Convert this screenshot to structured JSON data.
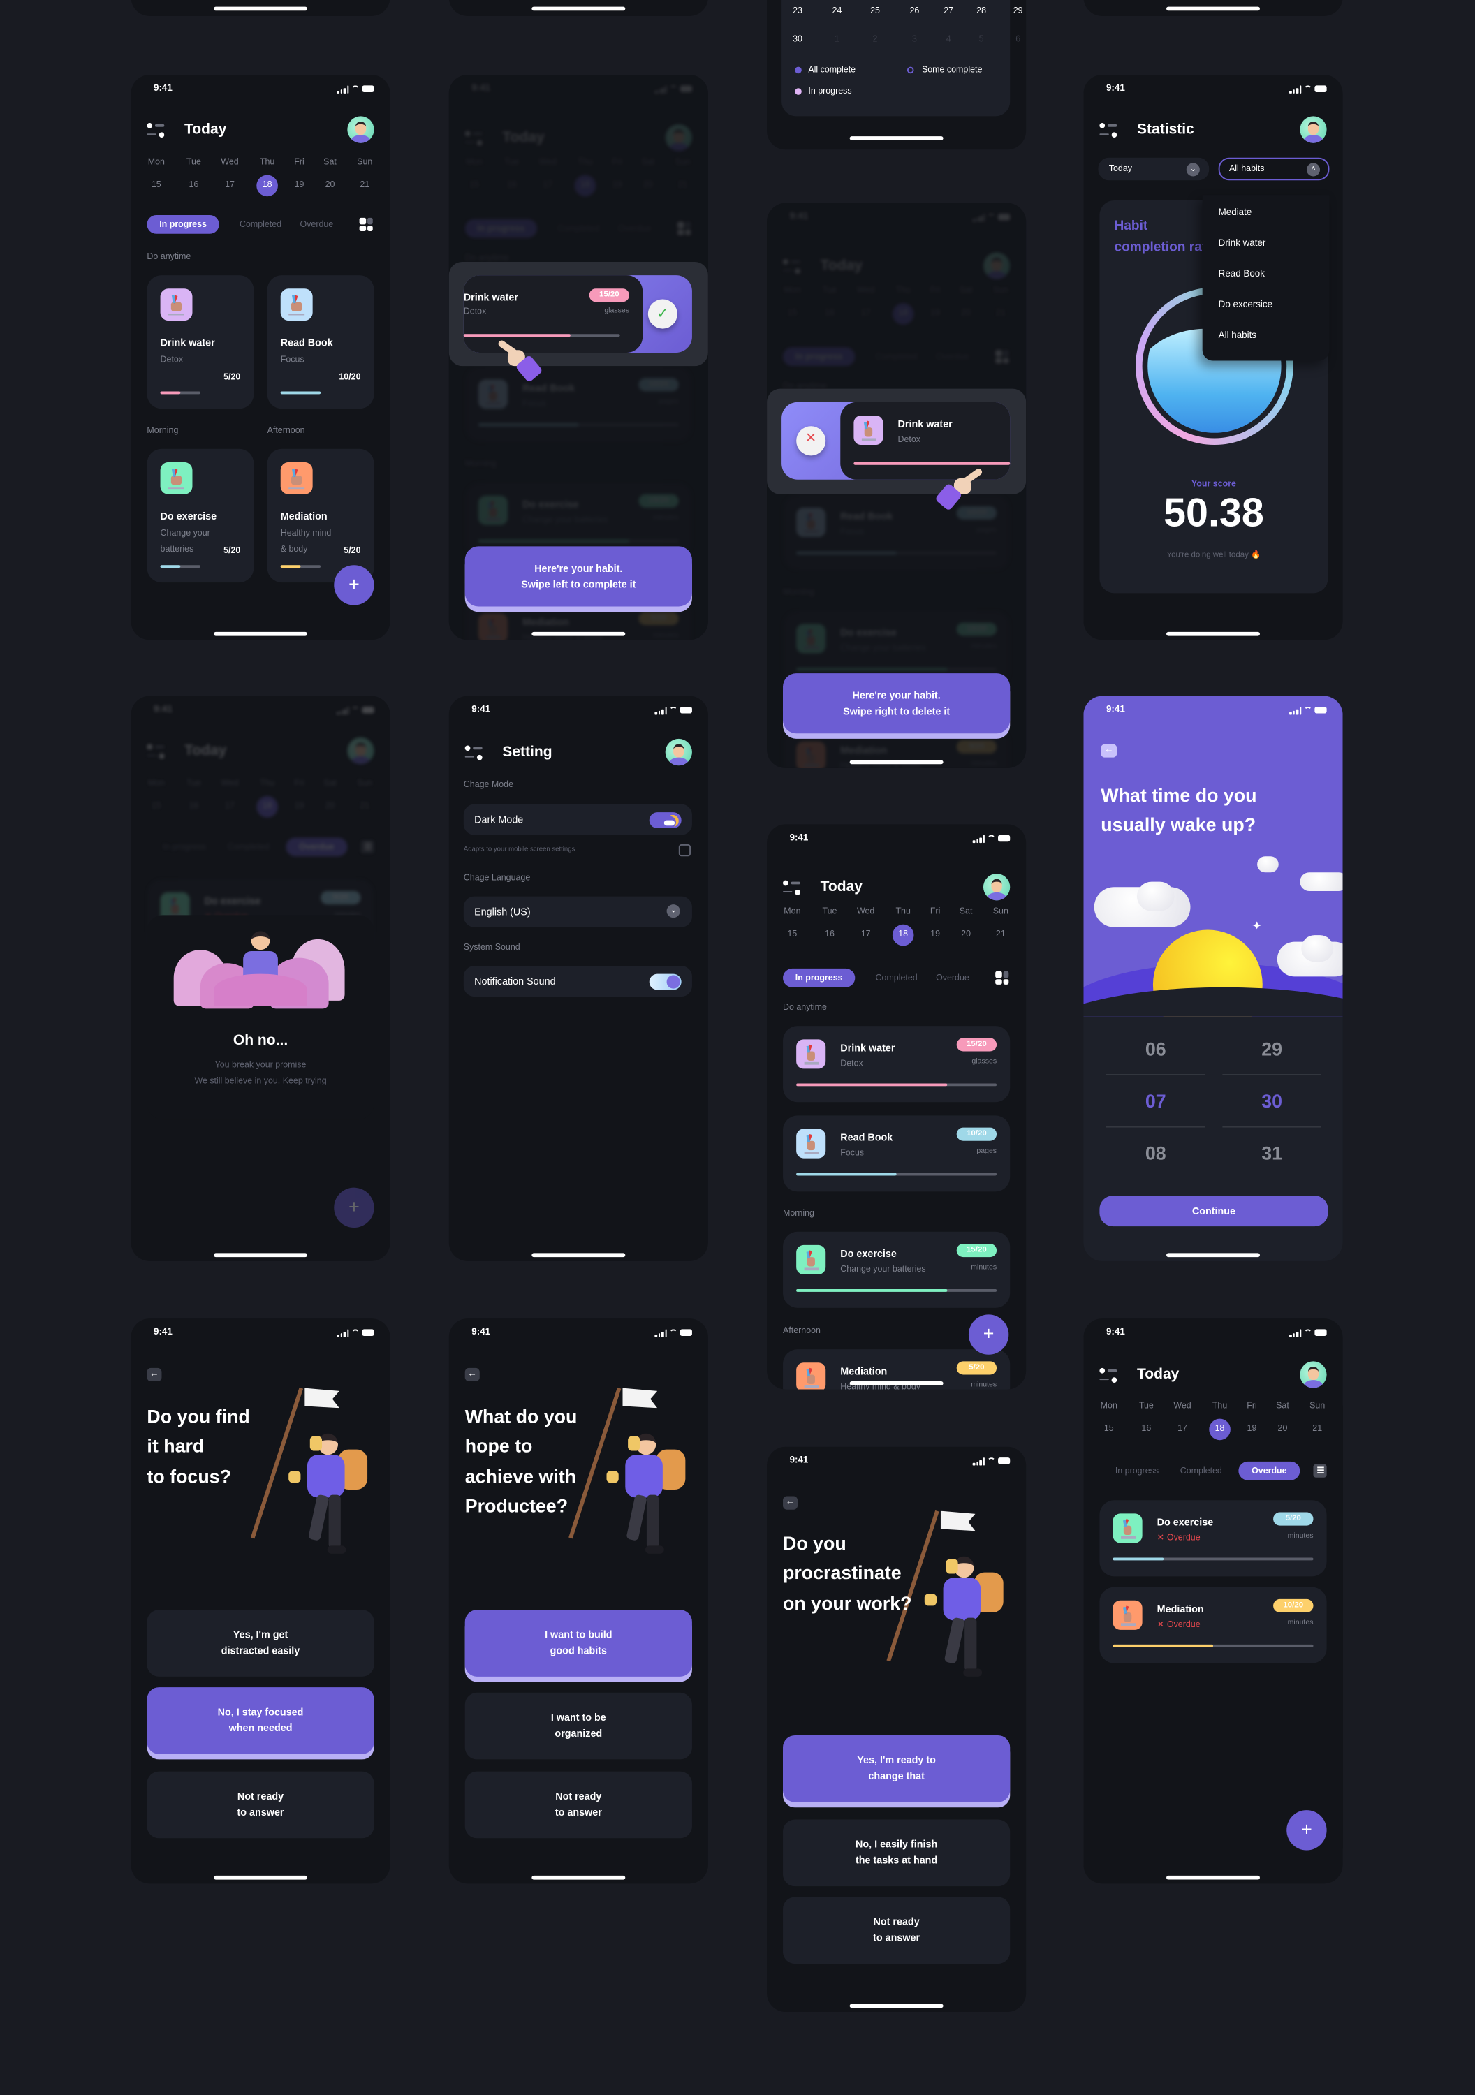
{
  "status_time": "9:41",
  "colors": {
    "accent": "#6c5dd3",
    "page_background": "#191b22",
    "phone_background": "#121419",
    "card": "#1d2029",
    "pink": "#f79aba",
    "blue": "#9fd8e8",
    "green": "#7ef0c0",
    "yellow": "#fdd06b",
    "overdue_red": "#e5484d",
    "muted_text": "#7d808c"
  },
  "icons": {
    "menu": "menu-dots-icon",
    "avatar": "user-avatar",
    "layout": "grid-layout-icon",
    "list": "list-layout-icon",
    "back": "arrow-left-icon",
    "chevron": "chevron-down-icon",
    "add": "plus-icon",
    "check": "check-icon",
    "delete": "x-icon"
  },
  "week": {
    "days": [
      "Mon",
      "Tue",
      "Wed",
      "Thu",
      "Fri",
      "Sat",
      "Sun"
    ],
    "dates": [
      "15",
      "16",
      "17",
      "18",
      "19",
      "20",
      "21"
    ],
    "selected": "18"
  },
  "tabs": {
    "in_progress": "In progress",
    "completed": "Completed",
    "overdue": "Overdue"
  },
  "labels": {
    "today": "Today",
    "do_anytime": "Do anytime",
    "morning": "Morning",
    "afternoon": "Afternoon"
  },
  "calendar": {
    "rows": [
      [
        "23",
        "24",
        "25",
        "26",
        "27",
        "28",
        "29"
      ],
      [
        "30",
        "1",
        "2",
        "3",
        "4",
        "5",
        "6"
      ]
    ],
    "legend": {
      "all_complete": "All complete",
      "some_complete": "Some complete",
      "in_progress": "In progress"
    }
  },
  "grid_habits": [
    {
      "name": "Drink water",
      "category": "Detox",
      "progress": "5/20",
      "value": 5,
      "goal": 20,
      "color": "#f79aba",
      "icon_bg": "#d9b4f5"
    },
    {
      "name": "Read Book",
      "category": "Focus",
      "progress": "10/20",
      "value": 10,
      "goal": 20,
      "color": "#9fd8e8",
      "icon_bg": "#bfe0fb"
    },
    {
      "name": "Do exercise",
      "category": "Change your\nbatteries",
      "progress": "5/20",
      "value": 5,
      "goal": 20,
      "color": "#9fd8e8",
      "icon_bg": "#7ef0c0"
    },
    {
      "name": "Mediation",
      "category": "Healthy mind\n& body",
      "progress": "5/20",
      "value": 5,
      "goal": 20,
      "color": "#fdd06b",
      "icon_bg": "#ff9a6c"
    }
  ],
  "list_habits": [
    {
      "name": "Drink water",
      "category": "Detox",
      "progress": "15/20",
      "value": 15,
      "goal": 20,
      "unit": "glasses",
      "color": "#f79aba",
      "icon_bg": "#d9b4f5"
    },
    {
      "name": "Read Book",
      "category": "Focus",
      "progress": "10/20",
      "value": 10,
      "goal": 20,
      "unit": "pages",
      "color": "#9fd8e8",
      "icon_bg": "#bfe0fb"
    },
    {
      "name": "Do exercise",
      "category": "Change your batteries",
      "progress": "15/20",
      "value": 15,
      "goal": 20,
      "unit": "minutes",
      "color": "#7ef0c0",
      "icon_bg": "#7ef0c0"
    },
    {
      "name": "Mediation",
      "category": "Healthy mind & body",
      "progress": "5/20",
      "value": 5,
      "goal": 20,
      "unit": "minutes",
      "color": "#fdd06b",
      "icon_bg": "#ff9a6c"
    }
  ],
  "overdue_habits": [
    {
      "name": "Do exercise",
      "status": "Overdue",
      "progress": "5/20",
      "value": 5,
      "goal": 20,
      "unit": "minutes",
      "color": "#9fd8e8",
      "icon_bg": "#7ef0c0"
    },
    {
      "name": "Mediation",
      "status": "Overdue",
      "progress": "10/20",
      "value": 10,
      "goal": 20,
      "unit": "minutes",
      "color": "#fdd06b",
      "icon_bg": "#ff9a6c"
    }
  ],
  "swipe_complete": {
    "hint": "Here're your habit.\nSwipe left to complete it"
  },
  "swipe_delete": {
    "hint": "Here're your habit.\nSwipe right to delete it"
  },
  "statistic": {
    "title": "Statistic",
    "period": "Today",
    "filter": "All habits",
    "menu": [
      "Mediate",
      "Drink water",
      "Read Book",
      "Do excersice",
      "All habits"
    ],
    "card_title": "Habit\ncompletion rate",
    "score_label": "Your score",
    "score": "50.38",
    "score_note": "You're doing well today 🔥"
  },
  "oh_no": {
    "title": "Oh no...",
    "line1": "You break your promise",
    "line2": "We still believe in you. Keep trying"
  },
  "setting": {
    "title": "Setting",
    "mode_label": "Chage Mode",
    "dark_mode": "Dark Mode",
    "dark_mode_on": true,
    "adapt_note": "Adapts to your mobile screen settings",
    "adapt_checked": false,
    "language_label": "Chage Language",
    "language": "English (US)",
    "sound_label": "System Sound",
    "notification_sound": "Notification Sound",
    "notification_on": true
  },
  "wake": {
    "title": "What time do you\nusually wake up?",
    "hours": [
      "06",
      "07",
      "08"
    ],
    "minutes": [
      "29",
      "30",
      "31"
    ],
    "selected_hour": "07",
    "selected_minute": "30",
    "continue": "Continue"
  },
  "questions": [
    {
      "title": "Do you find\nit hard\nto focus?",
      "options": [
        "Yes, I'm get\ndistracted easily",
        "No, I stay focused\nwhen needed",
        "Not ready\nto answer"
      ],
      "selected": 1
    },
    {
      "title": "What do you\nhope to\nachieve with\nProductee?",
      "options": [
        "I want to build\ngood habits",
        "I want to be\norganized",
        "Not ready\nto answer"
      ],
      "selected": 0
    },
    {
      "title": "Do you\nprocrastinate\non your work?",
      "options": [
        "Yes, I'm ready to\nchange that",
        "No, I easily finish\nthe tasks at hand",
        "Not ready\nto answer"
      ],
      "selected": 0
    }
  ]
}
